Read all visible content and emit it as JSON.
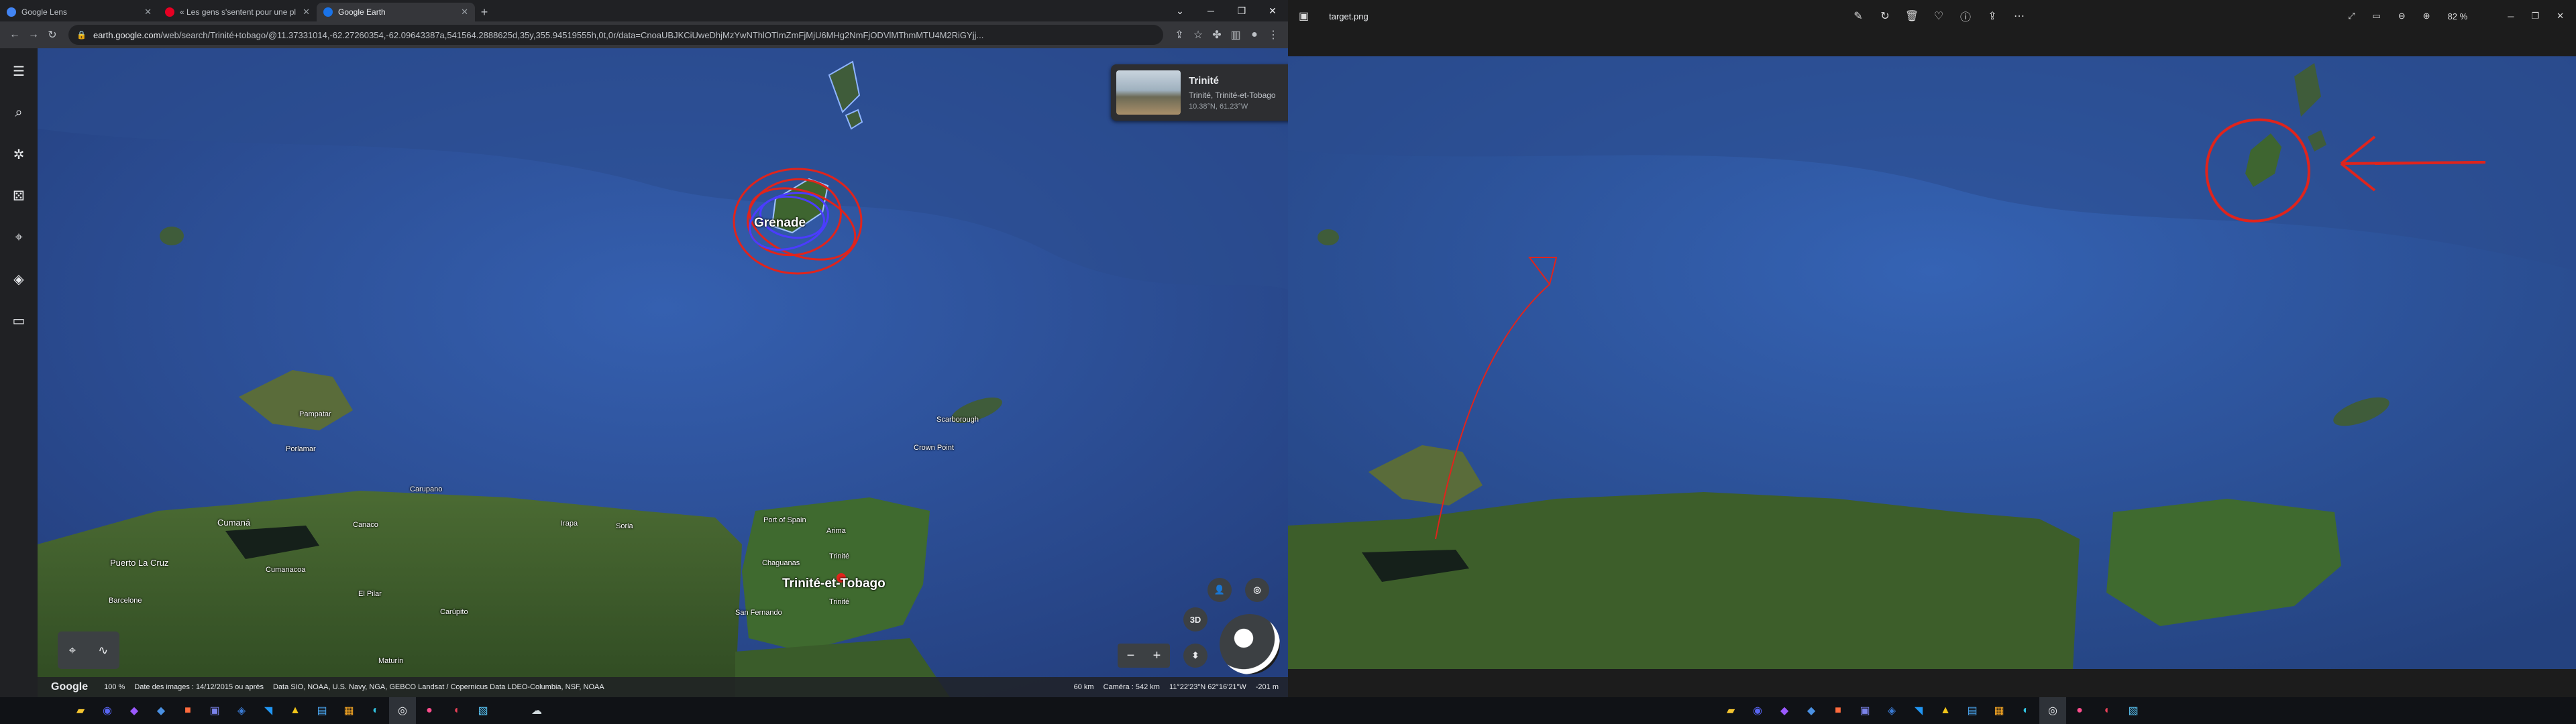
{
  "browser": {
    "tabs": [
      {
        "title": "Google Lens",
        "color": "#4285f4"
      },
      {
        "title": "« Les gens s'sentent pour une pl",
        "color": "#e60023"
      },
      {
        "title": "Google Earth",
        "color": "#1a73e8"
      }
    ],
    "new_tab": "+",
    "url_host": "earth.google.com",
    "url_path": "/web/search/Trinité+tobago/@11.37331014,-62.27260354,-62.09643387a,541564.2888625d,35y,355.94519555h,0t,0r/data=CnoaUBJKCiUweDhjMzYwNThlOTlmZmFjMjU6MHg2NmFjODVlMThmMTU4M2RiGYjj..."
  },
  "earth": {
    "labels": [
      {
        "text": "Grenade",
        "big": true
      },
      {
        "text": "Pampatar"
      },
      {
        "text": "Porlamar"
      },
      {
        "text": "Carupano"
      },
      {
        "text": "Cumaná"
      },
      {
        "text": "Canaco"
      },
      {
        "text": "Irapa"
      },
      {
        "text": "Soria"
      },
      {
        "text": "Port of Spain"
      },
      {
        "text": "Arima"
      },
      {
        "text": "Chaguanas"
      },
      {
        "text": "Trinité-et-Tobago",
        "big": true
      },
      {
        "text": "Trinité"
      },
      {
        "text": "San Fernando"
      },
      {
        "text": "Trinité"
      },
      {
        "text": "Puerto La Cruz"
      },
      {
        "text": "Barcelone"
      },
      {
        "text": "Cumanacoa"
      },
      {
        "text": "El Pilar"
      },
      {
        "text": "Carúpito"
      },
      {
        "text": "Maturín"
      },
      {
        "text": "Scarborough"
      },
      {
        "text": "Crown Point"
      }
    ],
    "info_card": {
      "title": "Trinité",
      "subtitle": "Trinité, Trinité-et-Tobago",
      "coords": "10.38°N, 61.23°W"
    },
    "buttons": {
      "three_d": "3D",
      "zoom_out": "−",
      "zoom_in": "+"
    },
    "status": {
      "logo": "Google",
      "zoom": "100 %",
      "imagery_date": "Date des images : 14/12/2015 ou après",
      "data_credits": "Data SIO, NOAA, U.S. Navy, NGA, GEBCO   Landsat / Copernicus   Data LDEO-Columbia, NSF, NOAA",
      "scale": "60 km",
      "camera": "Caméra : 542 km",
      "coordinates": "11°22'23\"N 62°16'21\"W",
      "elevation": "-201 m"
    }
  },
  "photos": {
    "filename": "target.png",
    "zoom": "82 %"
  },
  "colors": {
    "annotation": "#e0241c",
    "ocean": "#2a4f96"
  }
}
